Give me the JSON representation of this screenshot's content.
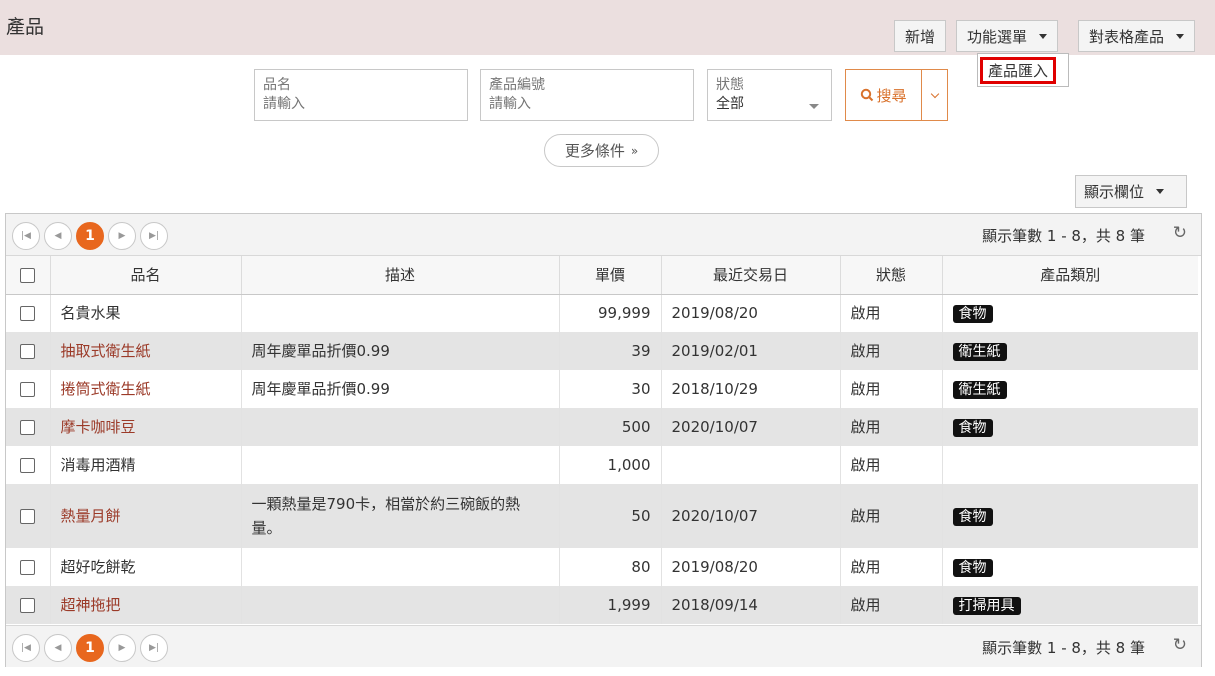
{
  "header": {
    "title": "產品",
    "add_label": "新增",
    "func_menu_label": "功能選單",
    "table_products_label": "對表格產品"
  },
  "dropdown": {
    "import_label": "產品匯入"
  },
  "search": {
    "name_label": "品名",
    "name_placeholder": "請輸入",
    "code_label": "產品編號",
    "code_placeholder": "請輸入",
    "status_label": "狀態",
    "status_value": "全部",
    "search_label": "搜尋",
    "more_label": "更多條件"
  },
  "columns_btn_label": "顯示欄位",
  "pager": {
    "current_page": "1",
    "info": "顯示筆數 1 - 8，共 8 筆"
  },
  "table": {
    "headers": [
      "品名",
      "描述",
      "單價",
      "最近交易日",
      "狀態",
      "產品類別"
    ],
    "rows": [
      {
        "name": "名貴水果",
        "desc": "",
        "price": "99,999",
        "date": "2019/08/20",
        "status": "啟用",
        "category": "食物"
      },
      {
        "name": "抽取式衛生紙",
        "desc": "周年慶單品折價0.99",
        "price": "39",
        "date": "2019/02/01",
        "status": "啟用",
        "category": "衛生紙"
      },
      {
        "name": "捲筒式衛生紙",
        "desc": "周年慶單品折價0.99",
        "price": "30",
        "date": "2018/10/29",
        "status": "啟用",
        "category": "衛生紙"
      },
      {
        "name": "摩卡咖啡豆",
        "desc": "",
        "price": "500",
        "date": "2020/10/07",
        "status": "啟用",
        "category": "食物"
      },
      {
        "name": "消毒用酒精",
        "desc": "",
        "price": "1,000",
        "date": "",
        "status": "啟用",
        "category": ""
      },
      {
        "name": "熱量月餅",
        "desc": "一顆熱量是790卡，相當於約三碗飯的熱量。",
        "price": "50",
        "date": "2020/10/07",
        "status": "啟用",
        "category": "食物"
      },
      {
        "name": "超好吃餅乾",
        "desc": "",
        "price": "80",
        "date": "2019/08/20",
        "status": "啟用",
        "category": "食物"
      },
      {
        "name": "超神拖把",
        "desc": "",
        "price": "1,999",
        "date": "2018/09/14",
        "status": "啟用",
        "category": "打掃用具"
      }
    ]
  }
}
